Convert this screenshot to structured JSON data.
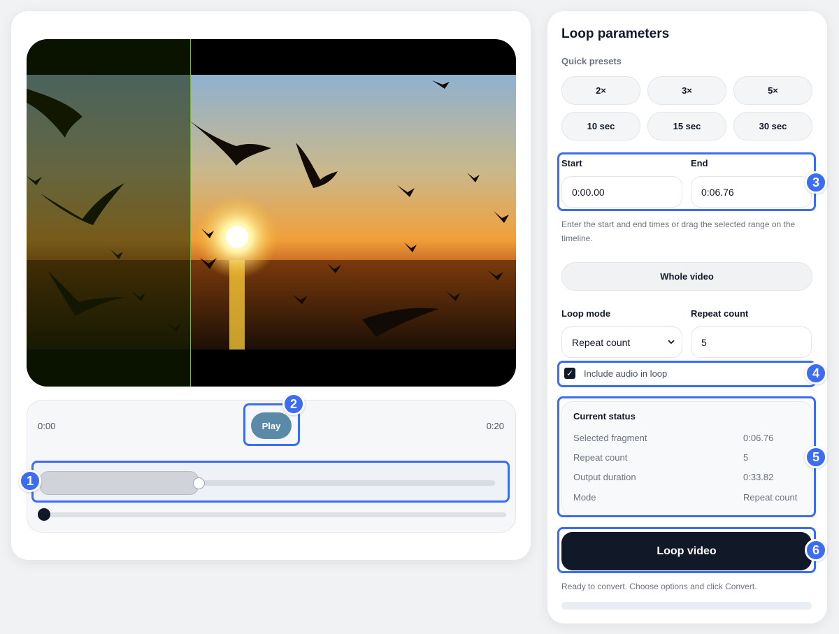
{
  "player": {
    "time_start": "0:00",
    "time_end": "0:20",
    "play_label": "Play",
    "selection_start_fraction": 0.0,
    "selection_end_fraction": 0.338,
    "playhead_fraction": 0.0
  },
  "panel": {
    "title": "Loop parameters",
    "presets_label": "Quick presets",
    "presets": [
      "2×",
      "3×",
      "5×",
      "10 sec",
      "15 sec",
      "30 sec"
    ],
    "start_label": "Start",
    "start_value": "0:00.00",
    "end_label": "End",
    "end_value": "0:06.76",
    "hint": "Enter the start and end times or drag the selected range on the timeline.",
    "whole_video_label": "Whole video",
    "loop_mode_label": "Loop mode",
    "loop_mode_value": "Repeat count",
    "repeat_count_label": "Repeat count",
    "repeat_count_value": "5",
    "include_audio_label": "Include audio in loop",
    "include_audio_checked": true
  },
  "status": {
    "title": "Current status",
    "rows": [
      {
        "key": "Selected fragment",
        "value": "0:06.76"
      },
      {
        "key": "Repeat count",
        "value": "5"
      },
      {
        "key": "Output duration",
        "value": "0:33.82"
      },
      {
        "key": "Mode",
        "value": "Repeat count"
      }
    ]
  },
  "action": {
    "loop_label": "Loop video",
    "ready_text": "Ready to convert. Choose options and click Convert.",
    "progress_fraction": 0.0
  },
  "badges": [
    "1",
    "2",
    "3",
    "4",
    "5",
    "6"
  ],
  "colors": {
    "accent": "#3b6cf2",
    "primary_dark": "#111827",
    "play_button": "#5a8aa8",
    "page_background": "#f1f2f4"
  }
}
